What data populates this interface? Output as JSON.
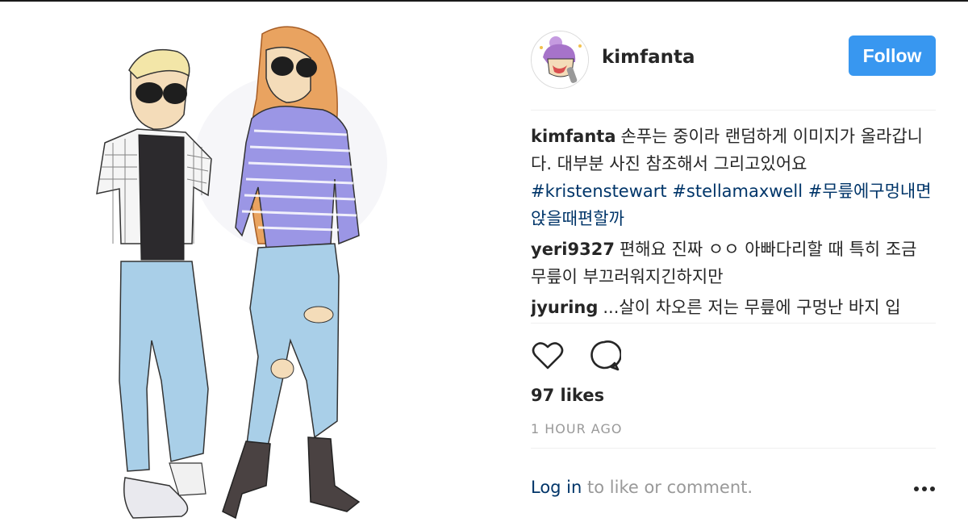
{
  "post": {
    "username": "kimfanta",
    "follow_label": "Follow",
    "caption": {
      "author": "kimfanta",
      "text": "손푸는 중이라 랜덤하게 이미지가 올라갑니다. 대부분 사진 참조해서 그리고있어요",
      "hashtags": "#kristenstewart #stellamaxwell #무릎에구멍내면앉을때편할까"
    },
    "comments": [
      {
        "author": "yeri9327",
        "text": "편해요 진짜 ㅇㅇ 아빠다리할 때 특히 조금 무릎이 부끄러워지긴하지만"
      },
      {
        "author": "jyuring",
        "text": "...살이 차오른 저는 무릎에 구멍난 바지 입"
      }
    ],
    "likes": "97 likes",
    "time": "1 HOUR AGO",
    "footer": {
      "login_label": "Log in",
      "rest_label": "to like or comment."
    }
  },
  "icons": {
    "like": "heart-icon",
    "comment": "comment-bubble-icon",
    "more": "more-options-icon",
    "avatar": "avatar-illustration"
  },
  "colors": {
    "follow_button": "#3897f0",
    "link": "#003569",
    "muted": "#999999",
    "text": "#262626"
  }
}
